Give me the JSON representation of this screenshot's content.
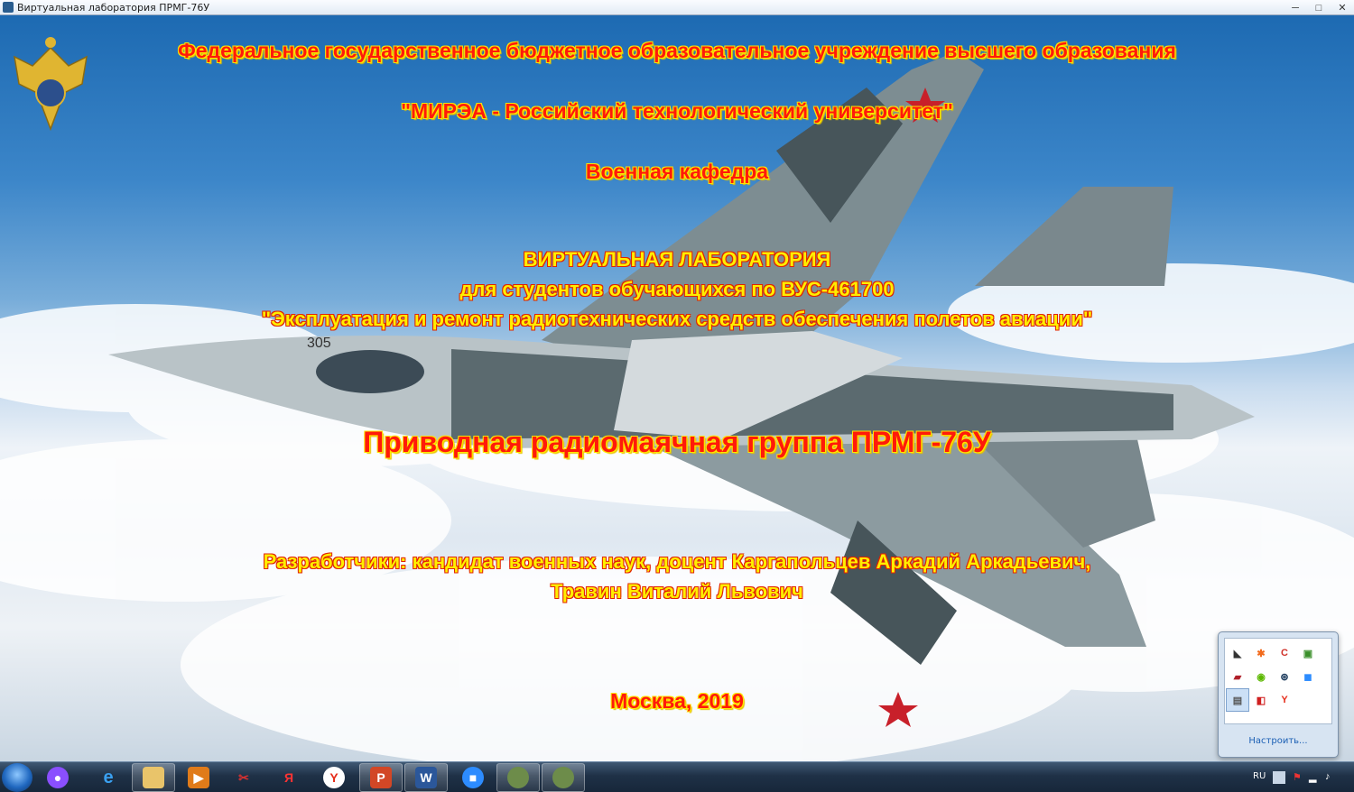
{
  "window": {
    "title": "Виртуальная лаборатория ПРМГ-76У"
  },
  "slide": {
    "line1": "Федеральное государственное бюджетное образовательное учреждение высшего образования",
    "line2": "\"МИРЭА - Российский технологический университет\"",
    "line3": "Военная кафедра",
    "line4": "ВИРТУАЛЬНАЯ ЛАБОРАТОРИЯ",
    "line5": "для студентов обучающихся по ВУС-461700",
    "line6": "\"Эксплуатация и ремонт радиотехнических средств обеспечения полетов авиации\"",
    "title": "Приводная радиомаячная группа ПРМГ-76У",
    "authors1": "Разработчики: кандидат военных наук, доцент Каргапольцев Аркадий Аркадьевич,",
    "authors2": "Травин Виталий Львович",
    "footer": "Москва, 2019",
    "jet_number": "305"
  },
  "tray_popup": {
    "customize": "Настроить...",
    "icons": [
      "app-icon",
      "avast-icon",
      "ccleaner-icon",
      "printer-icon",
      "speaker-icon",
      "nvidia-icon",
      "steam-icon",
      "zoom-icon",
      "network-icon",
      "flash-icon",
      "yandex-icon"
    ]
  },
  "taskbar": {
    "items": [
      "start",
      "alice",
      "internet-explorer",
      "explorer",
      "media-player",
      "tool",
      "yandex",
      "yandex-browser",
      "powerpoint",
      "word",
      "zoom",
      "lab-app-1",
      "lab-app-2"
    ],
    "language": "RU"
  },
  "colors": {
    "title_red": "#ff1a0a",
    "title_yellow": "#ffee00",
    "sky": "#3c86c9"
  }
}
